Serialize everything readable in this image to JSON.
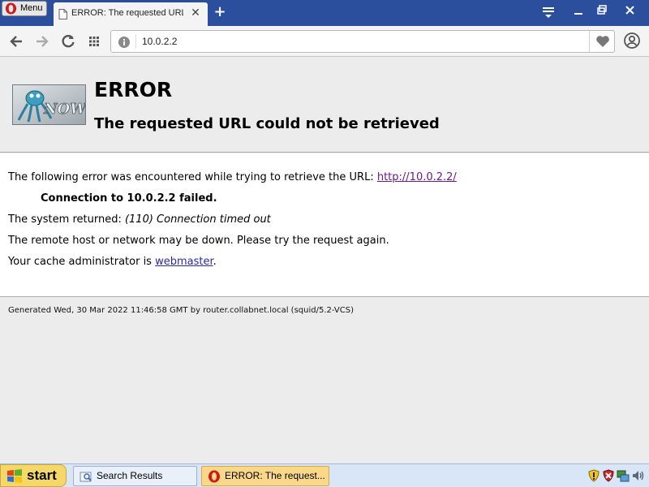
{
  "browser": {
    "menu_label": "Menu",
    "active_tab_title": "ERROR: The requested URL could not be retrieved",
    "address": "10.0.2.2"
  },
  "page": {
    "title": "ERROR",
    "subtitle": "The requested URL could not be retrieved",
    "line1_prefix": "The following error was encountered while trying to retrieve the URL: ",
    "line1_link": "http://10.0.2.2/",
    "line2": "Connection to 10.0.2.2 failed.",
    "line3_prefix": "The system returned: ",
    "line3_detail": "(110) Connection timed out",
    "line4": "The remote host or network may be down. Please try the request again.",
    "line5_prefix": "Your cache administrator is ",
    "line5_link": "webmaster",
    "line5_suffix": ".",
    "generated": "Generated Wed, 30 Mar 2022 11:46:58 GMT by router.collabnet.local (squid/5.2-VCS)",
    "logo_text": "NOW"
  },
  "taskbar": {
    "start_label": "start",
    "items": [
      {
        "label": "Search Results"
      },
      {
        "label": "ERROR: The request..."
      }
    ]
  },
  "colors": {
    "tabbar": "#2b4f9c",
    "link": "#2a2aa0",
    "visited_link": "#6a1a8a",
    "start_button": "#f6d86a",
    "taskbar": "#d9e6f7"
  },
  "icons": [
    "opera-icon",
    "document-icon",
    "close-icon",
    "plus-icon",
    "tab-menu-icon",
    "minimize-icon",
    "maximize-icon",
    "window-close-icon",
    "back-icon",
    "forward-icon",
    "reload-icon",
    "speed-dial-icon",
    "info-icon",
    "heart-icon",
    "account-icon",
    "windows-logo-icon",
    "folder-search-icon",
    "shield-icon",
    "security-icon",
    "network-icon",
    "speaker-icon"
  ]
}
